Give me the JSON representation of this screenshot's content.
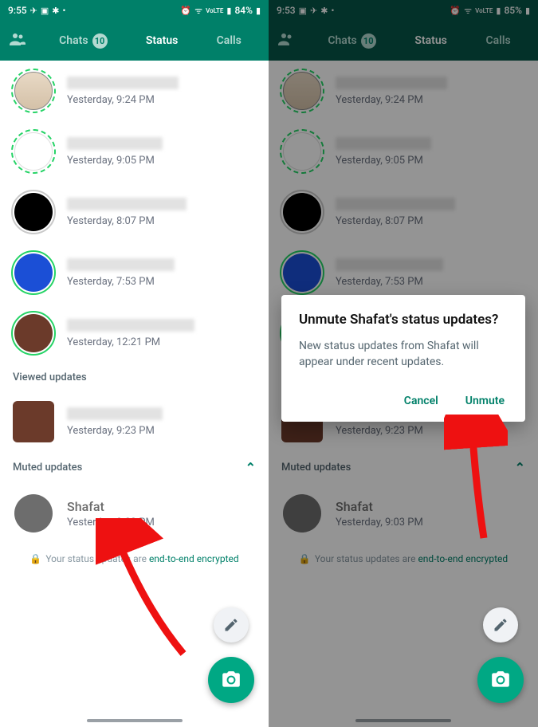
{
  "left": {
    "status_time": "9:55",
    "status_icons_left": [
      "send-icon",
      "image-icon",
      "slack-icon",
      "dot-icon"
    ],
    "battery": "84%",
    "tabs": {
      "chats": "Chats",
      "chats_badge": "10",
      "status": "Status",
      "calls": "Calls"
    },
    "updates": [
      {
        "time": "Yesterday, 9:24 PM",
        "ring": "dashed",
        "avatar": "bag",
        "nw": "w1"
      },
      {
        "time": "Yesterday, 9:05 PM",
        "ring": "dashed",
        "avatar": "doc",
        "nw": "w2"
      },
      {
        "time": "Yesterday, 8:07 PM",
        "ring": "gray",
        "avatar": "black",
        "nw": "w3"
      },
      {
        "time": "Yesterday, 7:53 PM",
        "ring": "solid",
        "avatar": "blue",
        "nw": "w4"
      },
      {
        "time": "Yesterday, 12:21 PM",
        "ring": "solid",
        "avatar": "brown",
        "nw": "w5"
      }
    ],
    "viewed_header": "Viewed updates",
    "viewed": [
      {
        "time": "Yesterday, 9:23 PM",
        "avatar": "sq",
        "nw": "w2"
      }
    ],
    "muted_header": "Muted updates",
    "muted": [
      {
        "name": "Shafat",
        "time": "Yesterday, 9:03 PM"
      }
    ],
    "enc_prefix": "Your status updates are",
    "enc_link": "end-to-end encrypted"
  },
  "right": {
    "status_time": "9:53",
    "battery": "85%",
    "dialog": {
      "title": "Unmute Shafat's status updates?",
      "body": "New status updates from Shafat will appear under recent updates.",
      "cancel": "Cancel",
      "confirm": "Unmute"
    }
  },
  "colors": {
    "primary": "#008069",
    "accent": "#00a884"
  }
}
